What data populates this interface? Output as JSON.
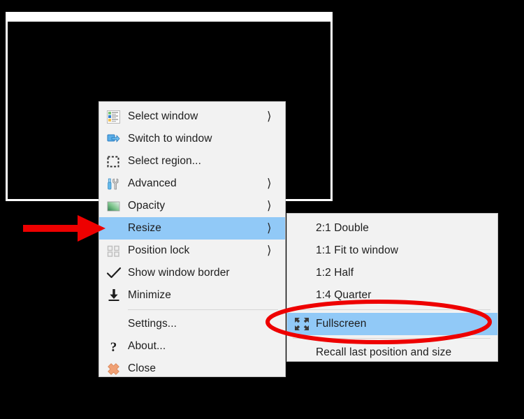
{
  "app_window": {
    "name": "background-window",
    "border_color": "#ffffff",
    "background_color": "#000000"
  },
  "colors": {
    "menu_background": "#f2f2f2",
    "menu_border": "#c4c4c4",
    "highlight": "#91c9f7",
    "text": "#1d1d1d",
    "annotation_red": "#ee0000",
    "desktop": "#000000"
  },
  "main_menu": {
    "name": "main-context-menu",
    "items": [
      {
        "label": "Select window",
        "icon": "window-list-icon",
        "submenu_arrow": "⟩",
        "has_submenu": true,
        "selected": false,
        "separator_after": false
      },
      {
        "label": "Switch to window",
        "icon": "switch-window-icon",
        "submenu_arrow": "",
        "has_submenu": false,
        "selected": false,
        "separator_after": false
      },
      {
        "label": "Select region...",
        "icon": "select-region-icon",
        "submenu_arrow": "",
        "has_submenu": false,
        "selected": false,
        "separator_after": false
      },
      {
        "label": "Advanced",
        "icon": "tools-icon",
        "submenu_arrow": "⟩",
        "has_submenu": true,
        "selected": false,
        "separator_after": false
      },
      {
        "label": "Opacity",
        "icon": "gradient-icon",
        "submenu_arrow": "⟩",
        "has_submenu": true,
        "selected": false,
        "separator_after": false
      },
      {
        "label": "Resize",
        "icon": "none-icon",
        "submenu_arrow": "⟩",
        "has_submenu": true,
        "selected": true,
        "separator_after": false
      },
      {
        "label": "Position lock",
        "icon": "position-lock-icon",
        "submenu_arrow": "⟩",
        "has_submenu": true,
        "selected": false,
        "separator_after": false
      },
      {
        "label": "Show window border",
        "icon": "checkmark-icon",
        "submenu_arrow": "",
        "has_submenu": false,
        "selected": false,
        "separator_after": false
      },
      {
        "label": "Minimize",
        "icon": "minimize-icon",
        "submenu_arrow": "",
        "has_submenu": false,
        "selected": false,
        "separator_after": true
      },
      {
        "label": "Settings...",
        "icon": "none-icon",
        "submenu_arrow": "",
        "has_submenu": false,
        "selected": false,
        "separator_after": false
      },
      {
        "label": "About...",
        "icon": "question-mark-icon",
        "submenu_arrow": "",
        "has_submenu": false,
        "selected": false,
        "separator_after": false
      },
      {
        "label": "Close",
        "icon": "close-x-icon",
        "submenu_arrow": "",
        "has_submenu": false,
        "selected": false,
        "separator_after": false
      }
    ]
  },
  "resize_submenu": {
    "name": "resize-submenu",
    "items": [
      {
        "label": "2:1 Double",
        "icon": "none-icon",
        "selected": false,
        "separator_after": false
      },
      {
        "label": "1:1 Fit to window",
        "icon": "none-icon",
        "selected": false,
        "separator_after": false
      },
      {
        "label": "1:2 Half",
        "icon": "none-icon",
        "selected": false,
        "separator_after": false
      },
      {
        "label": "1:4 Quarter",
        "icon": "none-icon",
        "selected": false,
        "separator_after": true
      },
      {
        "label": "Fullscreen",
        "icon": "fullscreen-icon",
        "selected": true,
        "separator_after": true
      },
      {
        "label": "Recall last position and size",
        "icon": "none-icon",
        "selected": false,
        "separator_after": false
      }
    ]
  },
  "annotations": {
    "arrow": {
      "name": "red-arrow-annotation",
      "points_to": "Resize",
      "color": "#ee0000"
    },
    "ellipse": {
      "name": "red-ellipse-annotation",
      "encircles": "Fullscreen",
      "color": "#ee0000"
    }
  }
}
